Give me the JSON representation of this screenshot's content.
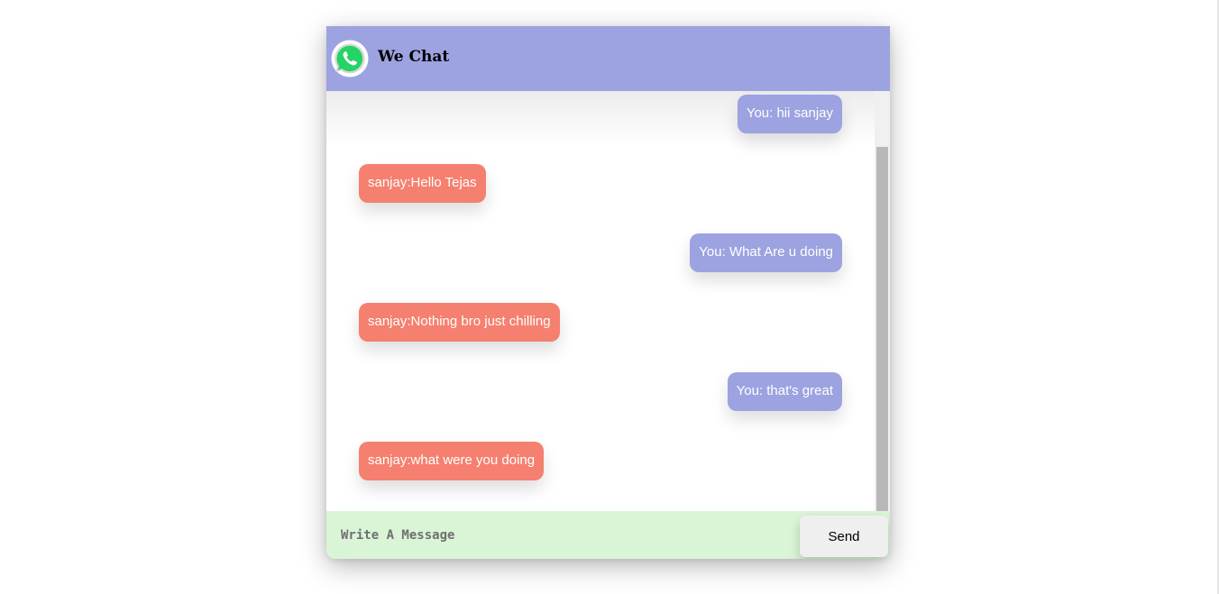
{
  "app": {
    "title": "We Chat",
    "logo_icon": "whatsapp-icon"
  },
  "colors": {
    "header_bg": "#9ca3e0",
    "outgoing_bubble": "#9ca3e0",
    "incoming_bubble": "#f5806f",
    "composer_bg": "#d9f5d6",
    "logo_green": "#25d366"
  },
  "messages": [
    {
      "direction": "out",
      "text": "You: hii sanjay"
    },
    {
      "direction": "in",
      "text": "sanjay:Hello Tejas"
    },
    {
      "direction": "out",
      "text": "You: What Are u doing"
    },
    {
      "direction": "in",
      "text": "sanjay:Nothing bro just chilling"
    },
    {
      "direction": "out",
      "text": "You: that's great"
    },
    {
      "direction": "in",
      "text": "sanjay:what were you doing"
    }
  ],
  "composer": {
    "placeholder": "Write A Message",
    "value": "",
    "send_label": "Send"
  }
}
